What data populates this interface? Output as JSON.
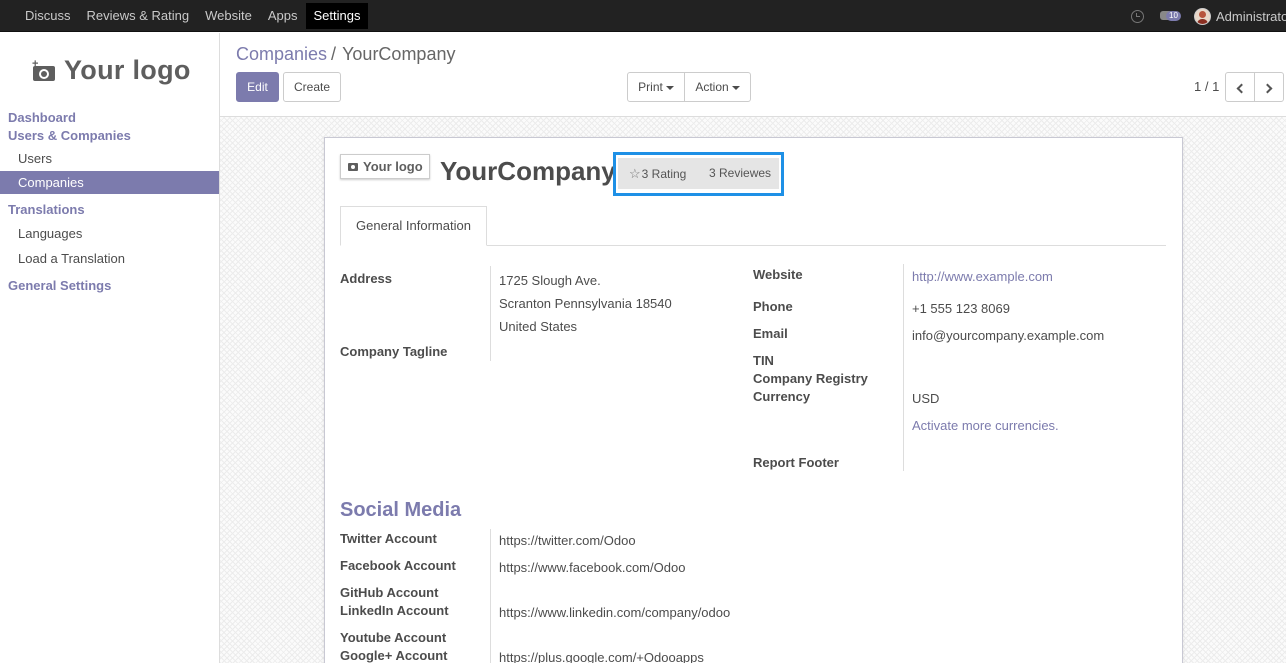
{
  "topbar": {
    "menu": [
      "Discuss",
      "Reviews & Rating",
      "Website",
      "Apps",
      "Settings"
    ],
    "active": "Settings",
    "message_count": "10",
    "user": "Administrator"
  },
  "sidebar": {
    "logo_text": "Your logo",
    "sections": [
      {
        "header": "Dashboard"
      },
      {
        "header": "Users & Companies",
        "items": [
          "Users",
          "Companies"
        ]
      },
      {
        "header": "Translations",
        "items": [
          "Languages",
          "Load a Translation"
        ]
      },
      {
        "header": "General Settings"
      }
    ],
    "active_item": "Companies"
  },
  "breadcrumb": {
    "parent": "Companies",
    "separator": "/",
    "current": "YourCompany"
  },
  "buttons": {
    "edit": "Edit",
    "create": "Create",
    "print": "Print",
    "action": "Action"
  },
  "pager": {
    "text": "1 / 1"
  },
  "record": {
    "logo_text": "Your logo",
    "name": "YourCompany",
    "stat_rating": "3 Rating",
    "stat_reviews": "3 Reviewes",
    "tab": "General Information",
    "left_fields": {
      "address_label": "Address",
      "address_lines": [
        "1725 Slough Ave.",
        "Scranton Pennsylvania 18540",
        "United States"
      ],
      "tagline_label": "Company Tagline"
    },
    "right_fields": {
      "website_label": "Website",
      "website": "http://www.example.com",
      "phone_label": "Phone",
      "phone": "+1 555 123 8069",
      "email_label": "Email",
      "email": "info@yourcompany.example.com",
      "tin_label": "TIN",
      "registry_label": "Company Registry",
      "currency_label": "Currency",
      "currency": "USD",
      "currency_link": "Activate more currencies.",
      "footer_label": "Report Footer"
    },
    "social": {
      "title": "Social Media",
      "twitter_label": "Twitter Account",
      "twitter": "https://twitter.com/Odoo",
      "facebook_label": "Facebook Account",
      "facebook": "https://www.facebook.com/Odoo",
      "github_label": "GitHub Account",
      "linkedin_label": "LinkedIn Account",
      "linkedin": "https://www.linkedin.com/company/odoo",
      "youtube_label": "Youtube Account",
      "googleplus_label": "Google+ Account",
      "googleplus": "https://plus.google.com/+Odooapps"
    }
  }
}
